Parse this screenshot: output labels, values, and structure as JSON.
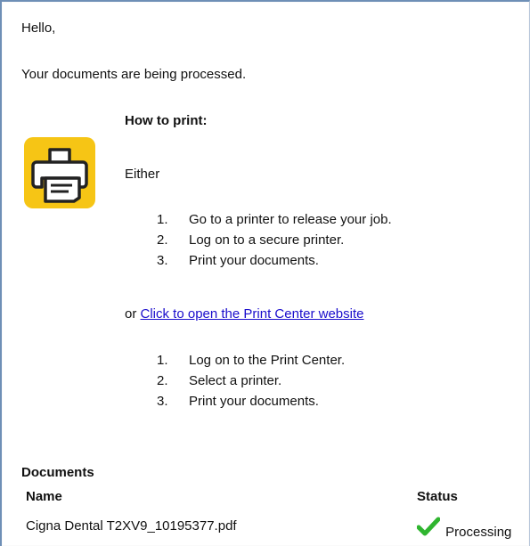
{
  "email": {
    "greeting": "Hello,",
    "intro": "Your documents are being processed.",
    "how_to_print": "How to print:",
    "either": "Either",
    "option1_steps": [
      {
        "num": "1.",
        "text": "Go to a printer to release your job."
      },
      {
        "num": "2.",
        "text": "Log on to a secure printer."
      },
      {
        "num": "3.",
        "text": "Print your documents."
      }
    ],
    "or_prefix": "or",
    "print_center_link": "Click to open the Print Center website",
    "option2_steps": [
      {
        "num": "1.",
        "text": "Log on to the Print Center."
      },
      {
        "num": "2.",
        "text": "Select a printer."
      },
      {
        "num": "3.",
        "text": "Print your documents."
      }
    ]
  },
  "documents": {
    "heading": "Documents",
    "columns": {
      "name": "Name",
      "status": "Status"
    },
    "rows": [
      {
        "name": "Cigna Dental T2XV9_10195377.pdf",
        "status": "Processing"
      }
    ]
  },
  "icons": {
    "printer": "printer-icon",
    "status": "checkmark-icon"
  },
  "colors": {
    "icon_background": "#f6c515",
    "link": "#1a0dcc",
    "check": "#2fb52f",
    "frame_border": "#6e8fb6"
  }
}
